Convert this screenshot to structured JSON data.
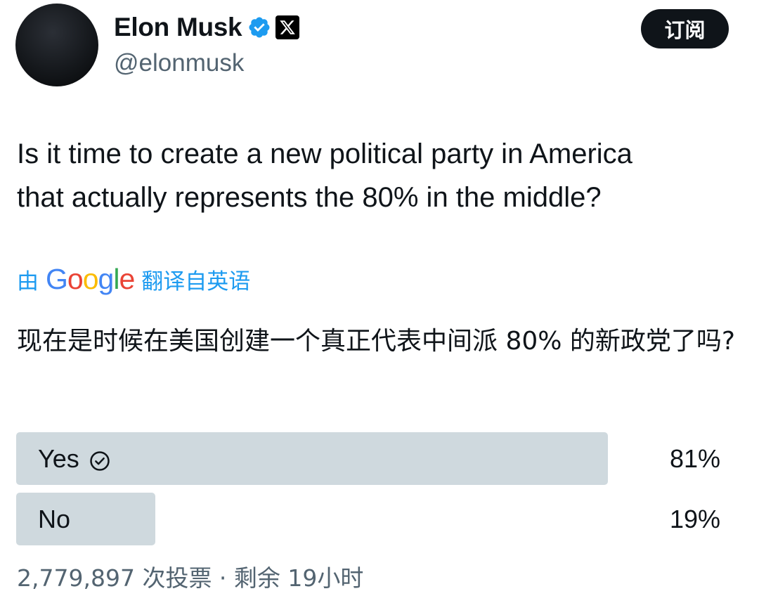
{
  "author": {
    "display_name": "Elon Musk",
    "handle": "@elonmusk",
    "avatar_icon": "avatar",
    "verified_icon": "verified-badge-icon",
    "affiliation_icon": "x-logo-icon"
  },
  "subscribe_label": "订阅",
  "tweet": {
    "text": "Is it time to create a new political party in America\nthat actually represents the 80% in the middle?"
  },
  "translation": {
    "prefix": "由",
    "google": [
      "G",
      "o",
      "o",
      "g",
      "l",
      "e"
    ],
    "suffix": "翻译自英语",
    "text": "现在是时候在美国创建一个真正代表中间派 80% 的新政党了吗?"
  },
  "poll": {
    "options": [
      {
        "label": "Yes",
        "percent_label": "81%",
        "percent": 81,
        "winner": true
      },
      {
        "label": "No",
        "percent_label": "19%",
        "percent": 19,
        "winner": false
      }
    ],
    "footer": "2,779,897 次投票 · 剩余 19小时"
  },
  "colors": {
    "link_blue": "#1d9bf0",
    "verified_blue": "#1d9bf0",
    "poll_bar": "#cfd9de",
    "secondary_text": "#536471"
  }
}
